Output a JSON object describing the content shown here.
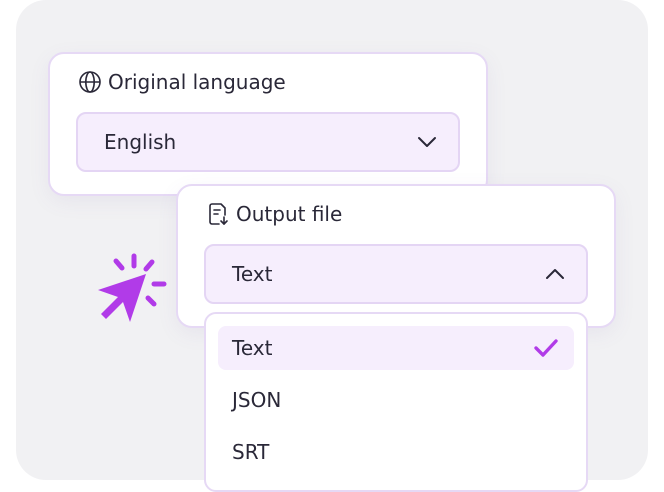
{
  "language": {
    "label": "Original language",
    "value": "English",
    "icon": "globe-icon"
  },
  "output": {
    "label": "Output file",
    "value": "Text",
    "icon": "file-export-icon",
    "options": [
      {
        "label": "Text",
        "selected": true
      },
      {
        "label": "JSON",
        "selected": false
      },
      {
        "label": "SRT",
        "selected": false
      }
    ]
  },
  "colors": {
    "accent": "#b13be8",
    "select_bg": "#f6eefd",
    "border": "#e6d9f5",
    "background": "#f1f1f3"
  }
}
